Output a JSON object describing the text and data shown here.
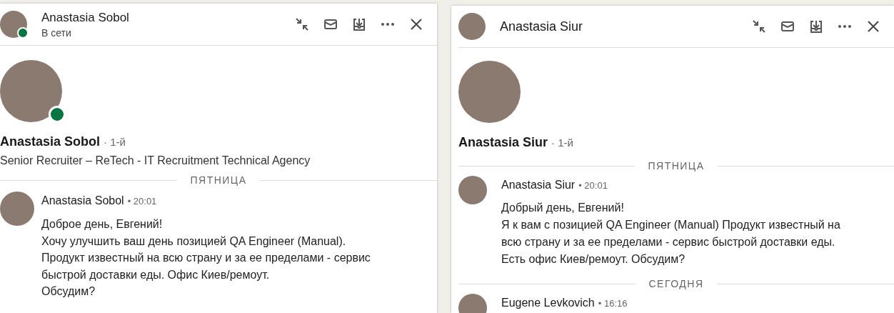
{
  "windows": [
    {
      "name": "Anastasia Sobol",
      "status": "В сети",
      "online": true,
      "profile": {
        "name": "Anastasia Sobol",
        "degree": "· 1-й",
        "headline": "Senior Recruiter – ReTech - IT Recruitment Technical Agency"
      },
      "days": [
        {
          "label": "ПЯТНИЦА",
          "messages": [
            {
              "sender": "Anastasia Sobol",
              "time": "• 20:01",
              "lines": [
                "Доброе день, Евгений!",
                "Хочу улучшить ваш день позицией QA Engineer (Manual).",
                "Продукт известный на всю страну и за ее пределами - сервис",
                "быстрой доставки еды. Офис Киев/ремоут.",
                "Обсудим?"
              ]
            }
          ]
        }
      ]
    },
    {
      "name": "Anastasia Siur",
      "online": false,
      "profile": {
        "name": "Anastasia Siur",
        "degree": "· 1-й"
      },
      "days": [
        {
          "label": "ПЯТНИЦА",
          "messages": [
            {
              "sender": "Anastasia Siur",
              "time": "• 20:01",
              "lines": [
                "Добрый день, Евгений!",
                "Я к вам с позицией QA Engineer (Manual) Продукт известный на",
                "всю страну и за ее пределами - сервис быстрой доставки еды.",
                "Есть офис Киев/ремоут. Обсудим?"
              ]
            }
          ]
        },
        {
          "label": "СЕГОДНЯ",
          "messages": [
            {
              "sender": "Eugene Levkovich",
              "time": "• 16:16"
            }
          ]
        }
      ]
    }
  ]
}
